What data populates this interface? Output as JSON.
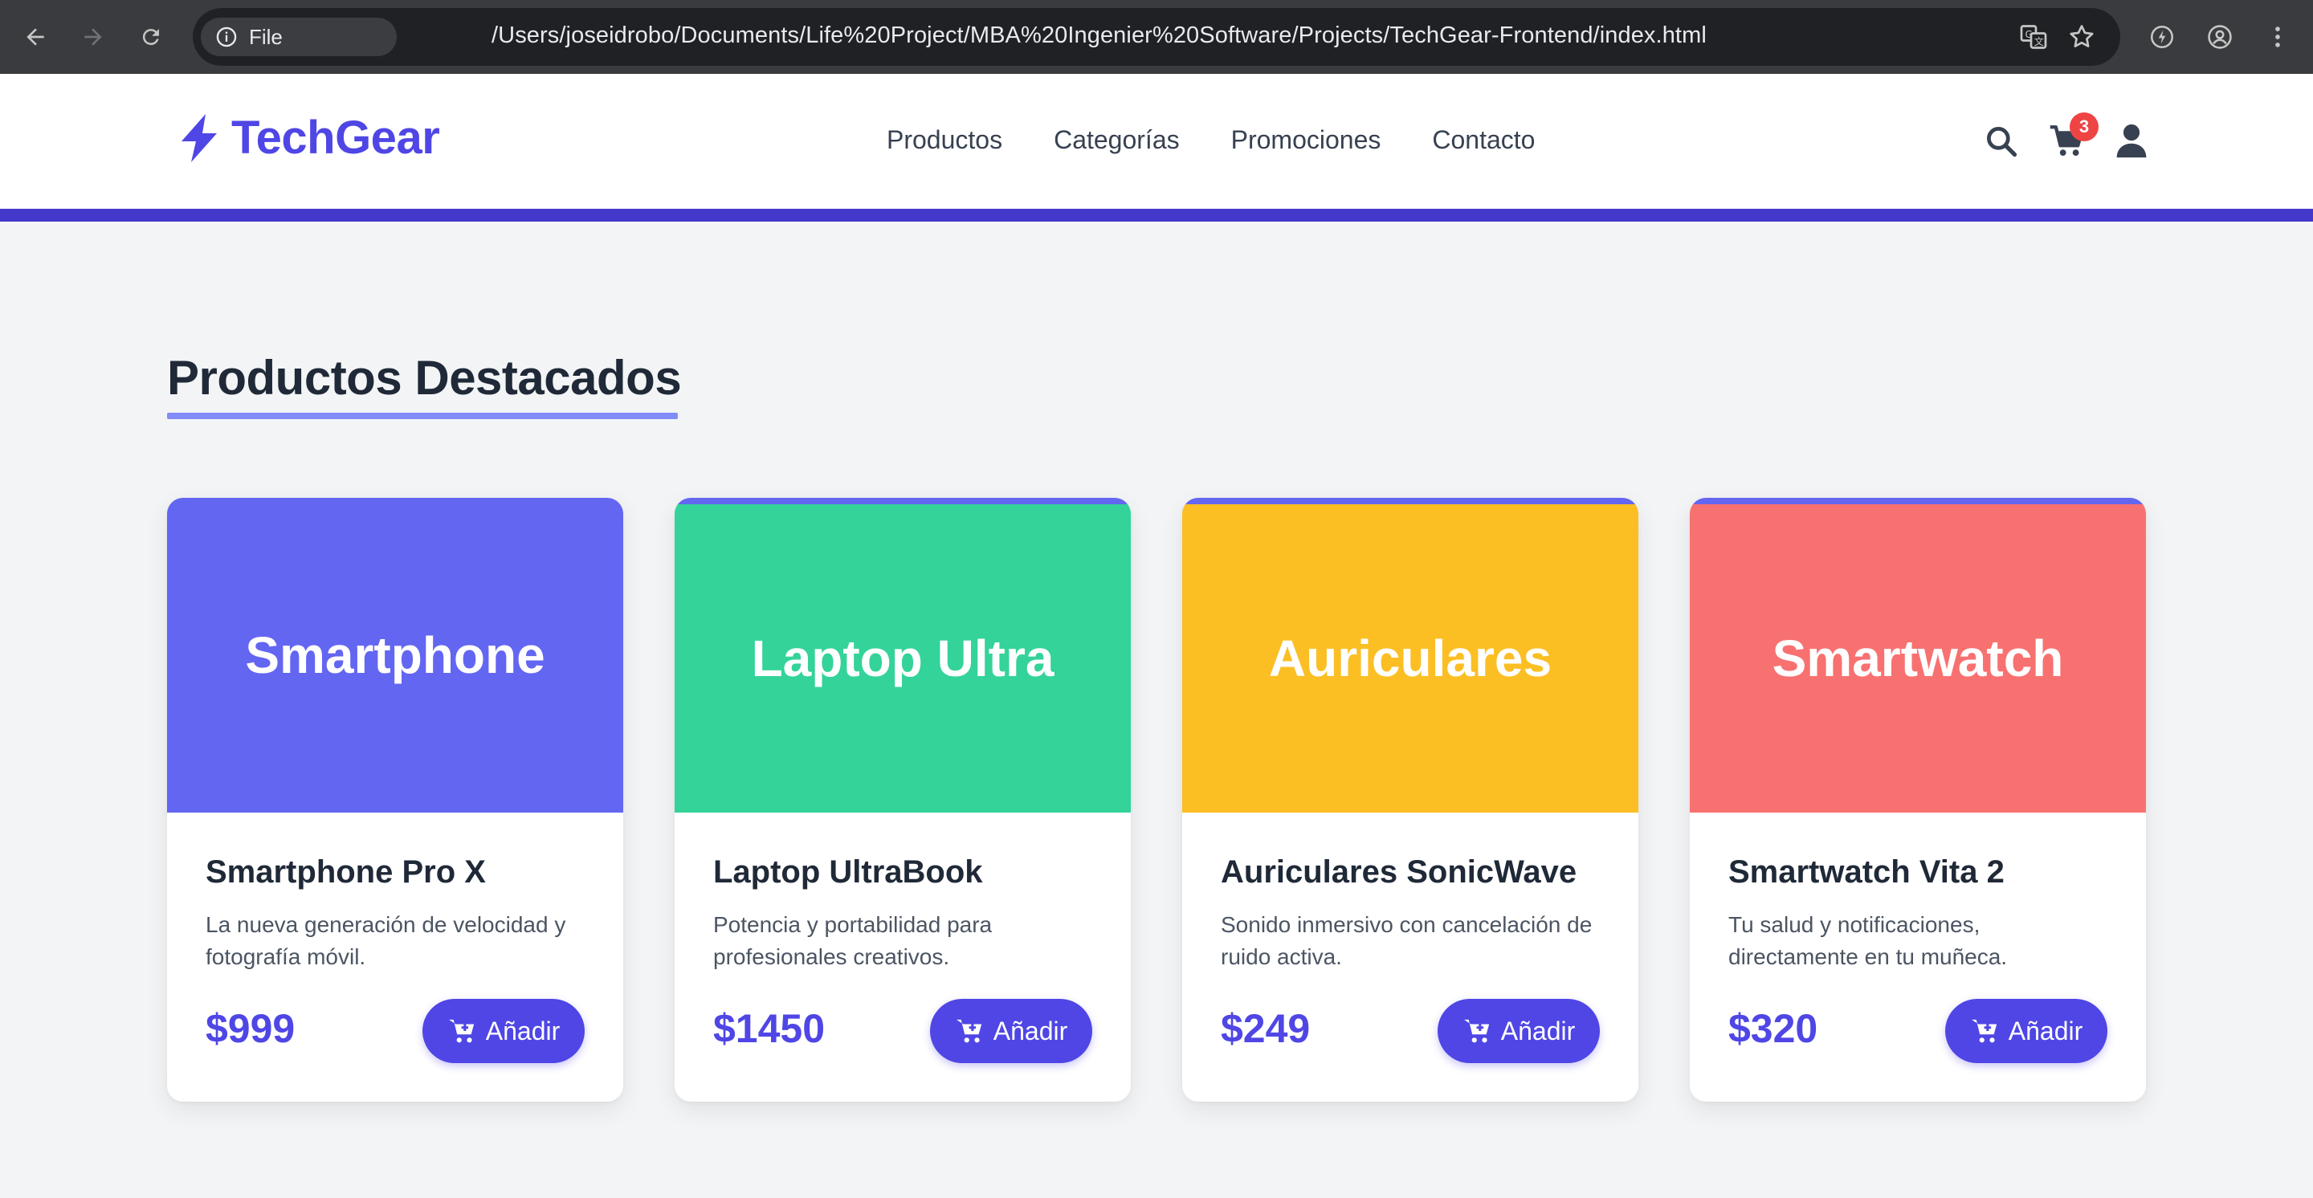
{
  "browser": {
    "file_chip": "File",
    "url": "/Users/joseidrobo/Documents/Life%20Project/MBA%20Ingenier%20Software/Projects/TechGear-Frontend/index.html"
  },
  "header": {
    "logo": "TechGear",
    "nav": [
      "Productos",
      "Categorías",
      "Promociones",
      "Contacto"
    ],
    "cart_count": "3",
    "accent_color": "#4338ca"
  },
  "section": {
    "title": "Productos Destacados"
  },
  "products": [
    {
      "banner": "Smartphone",
      "banner_color": "#6366f1",
      "name": "Smartphone Pro X",
      "description": "La nueva generación de velocidad y fotografía móvil.",
      "price": "$999",
      "button": "Añadir"
    },
    {
      "banner": "Laptop Ultra",
      "banner_color": "#34d399",
      "name": "Laptop UltraBook",
      "description": "Potencia y portabilidad para profesionales creativos.",
      "price": "$1450",
      "button": "Añadir"
    },
    {
      "banner": "Auriculares",
      "banner_color": "#fbbf24",
      "name": "Auriculares SonicWave",
      "description": "Sonido inmersivo con cancelación de ruido activa.",
      "price": "$249",
      "button": "Añadir"
    },
    {
      "banner": "Smartwatch",
      "banner_color": "#f87171",
      "name": "Smartwatch Vita 2",
      "description": "Tu salud y notificaciones, directamente en tu muñeca.",
      "price": "$320",
      "button": "Añadir"
    }
  ]
}
